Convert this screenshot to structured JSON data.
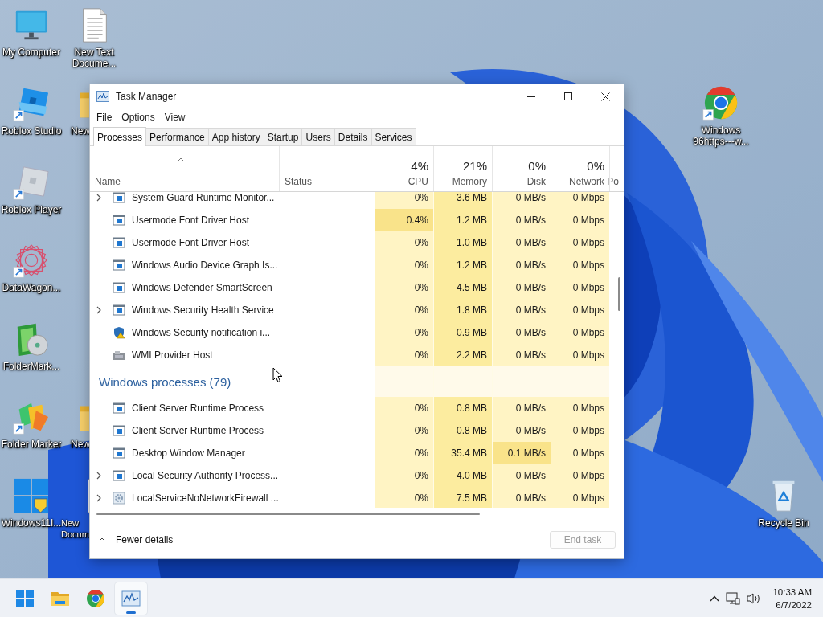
{
  "desktop_icons": [
    {
      "kind": "monitor",
      "label": "My Computer",
      "shortcut": false
    },
    {
      "kind": "document",
      "label": "New Text Docume...",
      "shortcut": false
    },
    {
      "kind": "studio",
      "label": "Roblox Studio",
      "shortcut": true
    },
    {
      "kind": "folder",
      "label": "New",
      "shortcut": false
    },
    {
      "kind": "player",
      "label": "Roblox Player",
      "shortcut": true
    },
    {
      "kind": "star",
      "label": "DataWagon...",
      "shortcut": true
    },
    {
      "kind": "boxdisc",
      "label": "FolderMark...",
      "shortcut": false
    },
    {
      "kind": "marker",
      "label": "Folder Marker",
      "shortcut": true
    },
    {
      "kind": "folder",
      "label": "New",
      "shortcut": false
    },
    {
      "kind": "winlogo",
      "label": "Windows11I...",
      "shortcut": false
    },
    {
      "kind": "document",
      "label": "New Docum",
      "shortcut": false
    },
    {
      "kind": "browser",
      "label": "Windows 96https---w...",
      "shortcut": true
    },
    {
      "kind": "recycle",
      "label": "Recycle Bin",
      "shortcut": false
    }
  ],
  "task_manager": {
    "title": "Task Manager",
    "menu": [
      "File",
      "Options",
      "View"
    ],
    "tabs": [
      {
        "label": "Processes",
        "selected": true
      },
      {
        "label": "Performance",
        "selected": false
      },
      {
        "label": "App history",
        "selected": false
      },
      {
        "label": "Startup",
        "selected": false
      },
      {
        "label": "Users",
        "selected": false
      },
      {
        "label": "Details",
        "selected": false
      },
      {
        "label": "Services",
        "selected": false
      }
    ],
    "columns": [
      {
        "label": "Name"
      },
      {
        "label": "Status"
      },
      {
        "label": "CPU",
        "total": "4%"
      },
      {
        "label": "Memory",
        "total": "21%"
      },
      {
        "label": "Disk",
        "total": "0%"
      },
      {
        "label": "Network",
        "total": "0%"
      },
      {
        "label": "Po"
      }
    ],
    "rows": [
      {
        "kind": "app",
        "expandable": true,
        "name": "System Guard Runtime Monitor...",
        "cells": [
          {
            "text": "0%",
            "high": false
          },
          {
            "text": "3.6 MB",
            "high": false
          },
          {
            "text": "0 MB/s",
            "high": false
          },
          {
            "text": "0 Mbps",
            "high": false
          }
        ]
      },
      {
        "kind": "app",
        "expandable": false,
        "name": "Usermode Font Driver Host",
        "cells": [
          {
            "text": "0.4%",
            "high": true
          },
          {
            "text": "1.2 MB",
            "high": false
          },
          {
            "text": "0 MB/s",
            "high": false
          },
          {
            "text": "0 Mbps",
            "high": false
          }
        ]
      },
      {
        "kind": "app",
        "expandable": false,
        "name": "Usermode Font Driver Host",
        "cells": [
          {
            "text": "0%",
            "high": false
          },
          {
            "text": "1.0 MB",
            "high": false
          },
          {
            "text": "0 MB/s",
            "high": false
          },
          {
            "text": "0 Mbps",
            "high": false
          }
        ]
      },
      {
        "kind": "app",
        "expandable": false,
        "name": "Windows Audio Device Graph Is...",
        "cells": [
          {
            "text": "0%",
            "high": false
          },
          {
            "text": "1.2 MB",
            "high": false
          },
          {
            "text": "0 MB/s",
            "high": false
          },
          {
            "text": "0 Mbps",
            "high": false
          }
        ]
      },
      {
        "kind": "app",
        "expandable": false,
        "name": "Windows Defender SmartScreen",
        "cells": [
          {
            "text": "0%",
            "high": false
          },
          {
            "text": "4.5 MB",
            "high": false
          },
          {
            "text": "0 MB/s",
            "high": false
          },
          {
            "text": "0 Mbps",
            "high": false
          }
        ]
      },
      {
        "kind": "app",
        "expandable": true,
        "name": "Windows Security Health Service",
        "cells": [
          {
            "text": "0%",
            "high": false
          },
          {
            "text": "1.8 MB",
            "high": false
          },
          {
            "text": "0 MB/s",
            "high": false
          },
          {
            "text": "0 Mbps",
            "high": false
          }
        ]
      },
      {
        "kind": "shield",
        "expandable": false,
        "name": "Windows Security notification i...",
        "cells": [
          {
            "text": "0%",
            "high": false
          },
          {
            "text": "0.9 MB",
            "high": false
          },
          {
            "text": "0 MB/s",
            "high": false
          },
          {
            "text": "0 Mbps",
            "high": false
          }
        ]
      },
      {
        "kind": "wmi",
        "expandable": false,
        "name": "WMI Provider Host",
        "cells": [
          {
            "text": "0%",
            "high": false
          },
          {
            "text": "2.2 MB",
            "high": false
          },
          {
            "text": "0 MB/s",
            "high": false
          },
          {
            "text": "0 Mbps",
            "high": false
          }
        ]
      },
      {
        "kind": "group",
        "label": "Windows processes (79)"
      },
      {
        "kind": "app",
        "expandable": false,
        "name": "Client Server Runtime Process",
        "cells": [
          {
            "text": "0%",
            "high": false
          },
          {
            "text": "0.8 MB",
            "high": false
          },
          {
            "text": "0 MB/s",
            "high": false
          },
          {
            "text": "0 Mbps",
            "high": false
          }
        ]
      },
      {
        "kind": "app",
        "expandable": false,
        "name": "Client Server Runtime Process",
        "cells": [
          {
            "text": "0%",
            "high": false
          },
          {
            "text": "0.8 MB",
            "high": false
          },
          {
            "text": "0 MB/s",
            "high": false
          },
          {
            "text": "0 Mbps",
            "high": false
          }
        ]
      },
      {
        "kind": "app",
        "expandable": false,
        "name": "Desktop Window Manager",
        "cells": [
          {
            "text": "0%",
            "high": false
          },
          {
            "text": "35.4 MB",
            "high": false
          },
          {
            "text": "0.1 MB/s",
            "high": true
          },
          {
            "text": "0 Mbps",
            "high": false
          }
        ]
      },
      {
        "kind": "app",
        "expandable": true,
        "name": "Local Security Authority Process...",
        "cells": [
          {
            "text": "0%",
            "high": false
          },
          {
            "text": "4.0 MB",
            "high": false
          },
          {
            "text": "0 MB/s",
            "high": false
          },
          {
            "text": "0 Mbps",
            "high": false
          }
        ]
      },
      {
        "kind": "gear",
        "expandable": true,
        "name": "LocalServiceNoNetworkFirewall ...",
        "cells": [
          {
            "text": "0%",
            "high": false
          },
          {
            "text": "7.5 MB",
            "high": false
          },
          {
            "text": "0 MB/s",
            "high": false
          },
          {
            "text": "0 Mbps",
            "high": false
          }
        ]
      }
    ],
    "footer": {
      "toggle": "Fewer details",
      "end_task": {
        "label": "End task",
        "disabled": true
      }
    }
  },
  "taskbar": {
    "apps": [
      {
        "kind": "start",
        "active": false
      },
      {
        "kind": "folder",
        "active": false
      },
      {
        "kind": "browser",
        "active": false
      },
      {
        "kind": "taskmgr",
        "active": true
      }
    ],
    "time": "10:33 AM",
    "date": "6/7/2022"
  }
}
